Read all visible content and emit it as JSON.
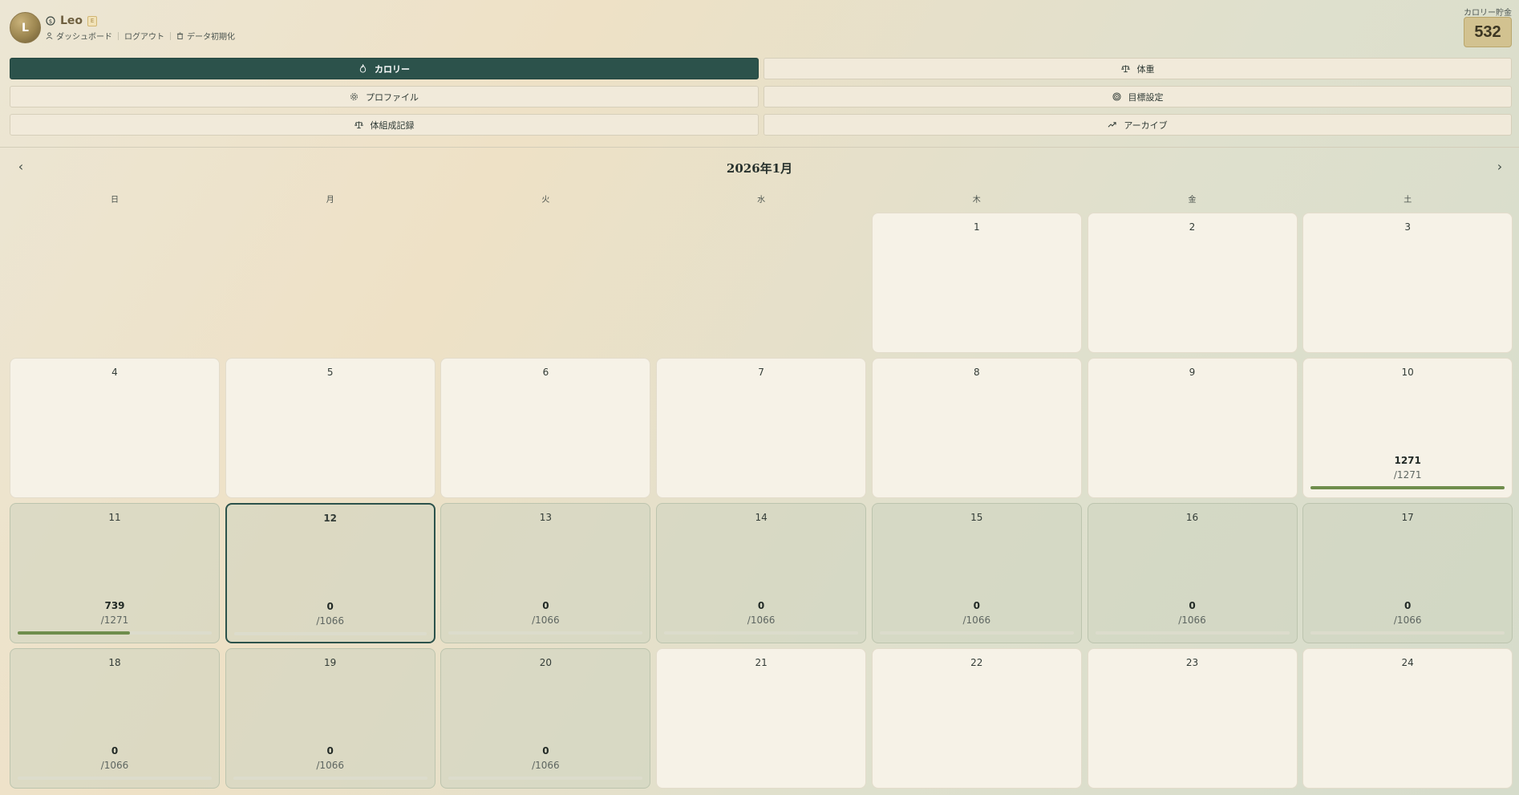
{
  "header": {
    "avatar_letter": "L",
    "username": "Leo",
    "badge": "E",
    "links": [
      "ダッシュボード",
      "ログアウト",
      "データ初期化"
    ],
    "savings_label": "カロリー貯金",
    "savings_value": "532"
  },
  "tabs": [
    {
      "label": "カロリー",
      "icon": "flame-icon",
      "active": true
    },
    {
      "label": "体重",
      "icon": "scale-icon",
      "active": false
    },
    {
      "label": "プロファイル",
      "icon": "gear-icon",
      "active": false
    },
    {
      "label": "目標設定",
      "icon": "target-icon",
      "active": false
    },
    {
      "label": "体組成記録",
      "icon": "scale-icon",
      "active": false
    },
    {
      "label": "アーカイブ",
      "icon": "trend-icon",
      "active": false
    }
  ],
  "calendar": {
    "month_title": "2026年1月",
    "prev": "‹",
    "next": "›",
    "weekdays": [
      "日",
      "月",
      "火",
      "水",
      "木",
      "金",
      "土"
    ],
    "days": [
      {
        "day": "1",
        "col": 4,
        "row": 0
      },
      {
        "day": "2",
        "col": 5,
        "row": 0
      },
      {
        "day": "3",
        "col": 6,
        "row": 0
      },
      {
        "day": "4",
        "col": 0,
        "row": 1
      },
      {
        "day": "5",
        "col": 1,
        "row": 1
      },
      {
        "day": "6",
        "col": 2,
        "row": 1
      },
      {
        "day": "7",
        "col": 3,
        "row": 1
      },
      {
        "day": "8",
        "col": 4,
        "row": 1
      },
      {
        "day": "9",
        "col": 5,
        "row": 1
      },
      {
        "day": "10",
        "col": 6,
        "row": 1,
        "eaten": "1271",
        "target": "/1271",
        "progress": 1.0,
        "state": "data"
      },
      {
        "day": "11",
        "col": 0,
        "row": 2,
        "eaten": "739",
        "target": "/1271",
        "progress": 0.58,
        "state": "past"
      },
      {
        "day": "12",
        "col": 1,
        "row": 2,
        "eaten": "0",
        "target": "/1066",
        "progress": 0,
        "state": "today"
      },
      {
        "day": "13",
        "col": 2,
        "row": 2,
        "eaten": "0",
        "target": "/1066",
        "progress": 0,
        "state": "past"
      },
      {
        "day": "14",
        "col": 3,
        "row": 2,
        "eaten": "0",
        "target": "/1066",
        "progress": 0,
        "state": "past"
      },
      {
        "day": "15",
        "col": 4,
        "row": 2,
        "eaten": "0",
        "target": "/1066",
        "progress": 0,
        "state": "past"
      },
      {
        "day": "16",
        "col": 5,
        "row": 2,
        "eaten": "0",
        "target": "/1066",
        "progress": 0,
        "state": "past"
      },
      {
        "day": "17",
        "col": 6,
        "row": 2,
        "eaten": "0",
        "target": "/1066",
        "progress": 0,
        "state": "past"
      },
      {
        "day": "18",
        "col": 0,
        "row": 3,
        "eaten": "0",
        "target": "/1066",
        "progress": 0,
        "state": "past"
      },
      {
        "day": "19",
        "col": 1,
        "row": 3,
        "eaten": "0",
        "target": "/1066",
        "progress": 0,
        "state": "past"
      },
      {
        "day": "20",
        "col": 2,
        "row": 3,
        "eaten": "0",
        "target": "/1066",
        "progress": 0,
        "state": "past"
      },
      {
        "day": "21",
        "col": 3,
        "row": 3
      },
      {
        "day": "22",
        "col": 4,
        "row": 3
      },
      {
        "day": "23",
        "col": 5,
        "row": 3
      },
      {
        "day": "24",
        "col": 6,
        "row": 3
      }
    ]
  },
  "colors": {
    "primary": "#2c524b",
    "progress": "#6f8d4c",
    "savings_bg": "#d2c290"
  }
}
